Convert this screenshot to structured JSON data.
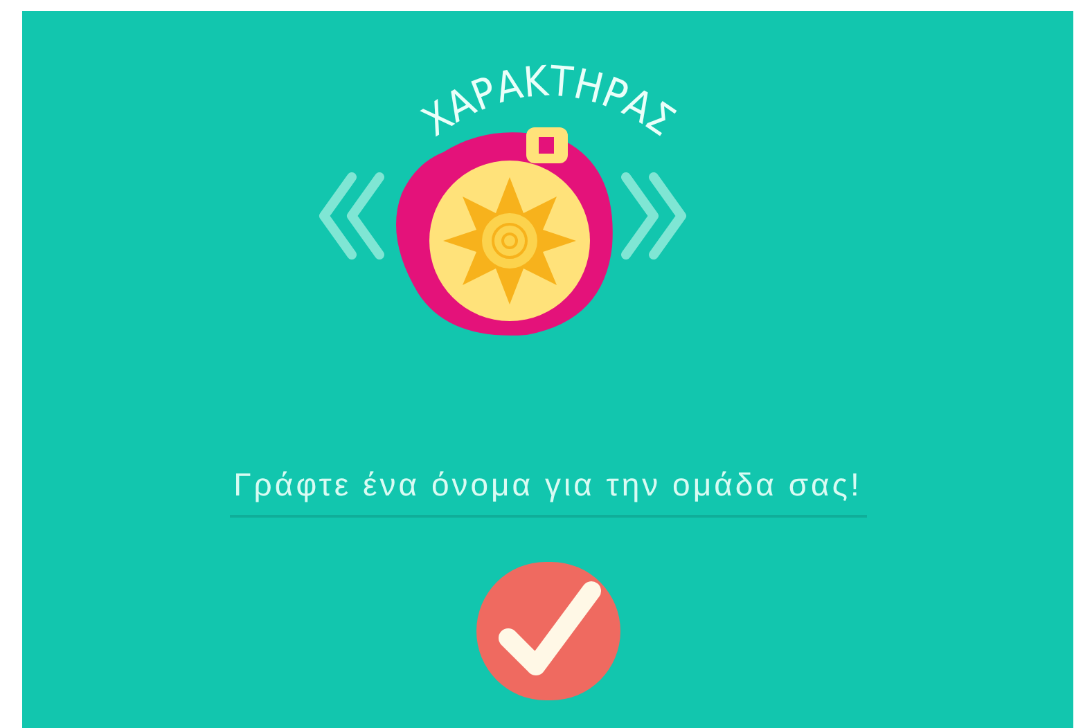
{
  "title": "ΧΑΡΑΚΤΗΡΑΣ",
  "team_name_field": {
    "placeholder": "Γράφτε ένα όνομα για την ομάδα σας!"
  }
}
